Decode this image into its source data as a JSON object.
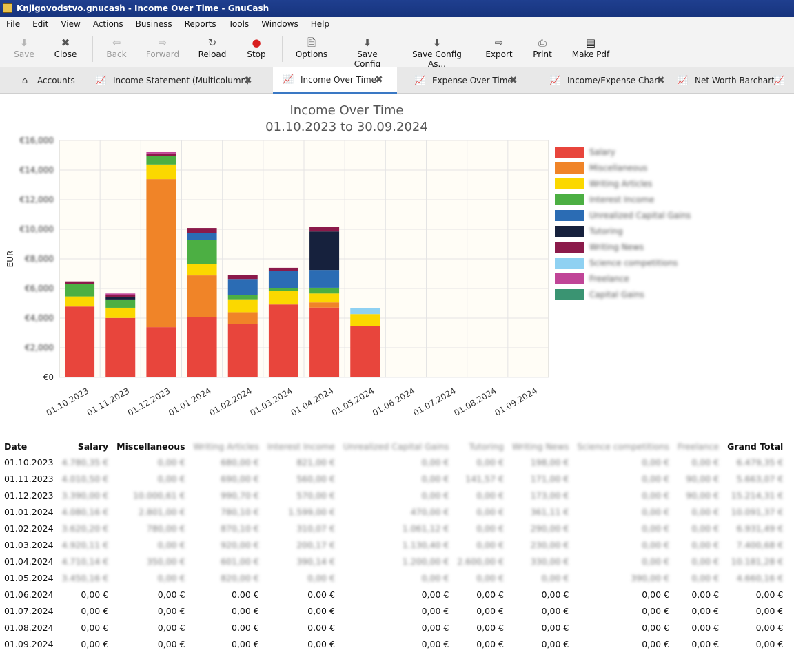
{
  "window": {
    "title": "Knjigovodstvo.gnucash - Income Over Time - GnuCash"
  },
  "menu": [
    "File",
    "Edit",
    "View",
    "Actions",
    "Business",
    "Reports",
    "Tools",
    "Windows",
    "Help"
  ],
  "toolbar": {
    "save": "Save",
    "close": "Close",
    "back": "Back",
    "forward": "Forward",
    "reload": "Reload",
    "stop": "Stop",
    "options": "Options",
    "save_config": "Save Config",
    "save_config_as": "Save Config As...",
    "export": "Export",
    "print": "Print",
    "make_pdf": "Make Pdf"
  },
  "tabs": [
    "Accounts",
    "Income Statement (Multicolumn)",
    "Income Over Time",
    "Expense Over Time",
    "Income/Expense Chart",
    "Net Worth Barchart"
  ],
  "chart_data": {
    "type": "bar",
    "stacked": true,
    "title": "Income Over Time",
    "subtitle": "01.10.2023 to 30.09.2024",
    "ylabel": "EUR",
    "ylim": [
      0,
      16000
    ],
    "y_ticks": [
      "€0",
      "€2,000",
      "€4,000",
      "€6,000",
      "€8,000",
      "€10,000",
      "€12,000",
      "€14,000",
      "€16,000"
    ],
    "legend_position": "right",
    "categories": [
      "01.10.2023",
      "01.11.2023",
      "01.12.2023",
      "01.01.2024",
      "01.02.2024",
      "01.03.2024",
      "01.04.2024",
      "01.05.2024",
      "01.06.2024",
      "01.07.2024",
      "01.08.2024",
      "01.09.2024"
    ],
    "series": [
      {
        "name": "Salary",
        "color": "#e8453c",
        "values": [
          4780,
          4010,
          3390,
          4080,
          3620,
          4920,
          4710,
          3450,
          0,
          0,
          0,
          0
        ]
      },
      {
        "name": "Miscellaneous",
        "color": "#f08428",
        "values": [
          0,
          0,
          10000,
          2800,
          780,
          0,
          350,
          0,
          0,
          0,
          0,
          0
        ]
      },
      {
        "name": "Writing Articles",
        "color": "#fbd800",
        "values": [
          680,
          690,
          990,
          780,
          870,
          920,
          600,
          820,
          0,
          0,
          0,
          0
        ]
      },
      {
        "name": "Interest Income",
        "color": "#4caf43",
        "values": [
          820,
          560,
          570,
          1600,
          310,
          200,
          390,
          0,
          0,
          0,
          0,
          0
        ]
      },
      {
        "name": "Unrealized Capital Gains",
        "color": "#2b6cb4",
        "values": [
          0,
          0,
          0,
          470,
          1060,
          1130,
          1200,
          0,
          0,
          0,
          0,
          0
        ]
      },
      {
        "name": "Tutoring",
        "color": "#16213d",
        "values": [
          0,
          140,
          0,
          0,
          0,
          0,
          2600,
          0,
          0,
          0,
          0,
          0
        ]
      },
      {
        "name": "Writing News",
        "color": "#8b1a4a",
        "values": [
          200,
          170,
          170,
          360,
          290,
          230,
          330,
          0,
          0,
          0,
          0,
          0
        ]
      },
      {
        "name": "Science competitions",
        "color": "#8fd1f2",
        "values": [
          0,
          0,
          0,
          0,
          0,
          0,
          0,
          390,
          0,
          0,
          0,
          0
        ]
      },
      {
        "name": "Freelance",
        "color": "#c04597",
        "values": [
          0,
          90,
          90,
          0,
          0,
          0,
          0,
          0,
          0,
          0,
          0,
          0
        ]
      },
      {
        "name": "Capital Gains",
        "color": "#3a9472",
        "values": [
          0,
          0,
          0,
          0,
          0,
          0,
          0,
          0,
          0,
          0,
          0,
          0
        ]
      }
    ]
  },
  "table": {
    "headers": [
      "Date",
      "Salary",
      "Miscellaneous",
      "Writing Articles",
      "Interest Income",
      "Unrealized Capital Gains",
      "Tutoring",
      "Writing News",
      "Science competitions",
      "Freelance",
      "Grand Total"
    ],
    "rows": [
      [
        "01.10.2023",
        "4.780,35 €",
        "0,00 €",
        "680,00 €",
        "821,00 €",
        "0,00 €",
        "0,00 €",
        "198,00 €",
        "0,00 €",
        "0,00 €",
        "6.479,35 €"
      ],
      [
        "01.11.2023",
        "4.010,50 €",
        "0,00 €",
        "690,00 €",
        "560,00 €",
        "0,00 €",
        "141,57 €",
        "171,00 €",
        "0,00 €",
        "90,00 €",
        "5.663,07 €"
      ],
      [
        "01.12.2023",
        "3.390,00 €",
        "10.000,61 €",
        "990,70 €",
        "570,00 €",
        "0,00 €",
        "0,00 €",
        "173,00 €",
        "0,00 €",
        "90,00 €",
        "15.214,31 €"
      ],
      [
        "01.01.2024",
        "4.080,16 €",
        "2.801,00 €",
        "780,10 €",
        "1.599,00 €",
        "470,00 €",
        "0,00 €",
        "361,11 €",
        "0,00 €",
        "0,00 €",
        "10.091,37 €"
      ],
      [
        "01.02.2024",
        "3.620,20 €",
        "780,00 €",
        "870,10 €",
        "310,07 €",
        "1.061,12 €",
        "0,00 €",
        "290,00 €",
        "0,00 €",
        "0,00 €",
        "6.931,49 €"
      ],
      [
        "01.03.2024",
        "4.920,11 €",
        "0,00 €",
        "920,00 €",
        "200,17 €",
        "1.130,40 €",
        "0,00 €",
        "230,00 €",
        "0,00 €",
        "0,00 €",
        "7.400,68 €"
      ],
      [
        "01.04.2024",
        "4.710,14 €",
        "350,00 €",
        "601,00 €",
        "390,14 €",
        "1.200,00 €",
        "2.600,00 €",
        "330,00 €",
        "0,00 €",
        "0,00 €",
        "10.181,28 €"
      ],
      [
        "01.05.2024",
        "3.450,16 €",
        "0,00 €",
        "820,00 €",
        "0,00 €",
        "0,00 €",
        "0,00 €",
        "0,00 €",
        "390,00 €",
        "0,00 €",
        "4.660,16 €"
      ],
      [
        "01.06.2024",
        "0,00 €",
        "0,00 €",
        "0,00 €",
        "0,00 €",
        "0,00 €",
        "0,00 €",
        "0,00 €",
        "0,00 €",
        "0,00 €",
        "0,00 €"
      ],
      [
        "01.07.2024",
        "0,00 €",
        "0,00 €",
        "0,00 €",
        "0,00 €",
        "0,00 €",
        "0,00 €",
        "0,00 €",
        "0,00 €",
        "0,00 €",
        "0,00 €"
      ],
      [
        "01.08.2024",
        "0,00 €",
        "0,00 €",
        "0,00 €",
        "0,00 €",
        "0,00 €",
        "0,00 €",
        "0,00 €",
        "0,00 €",
        "0,00 €",
        "0,00 €"
      ],
      [
        "01.09.2024",
        "0,00 €",
        "0,00 €",
        "0,00 €",
        "0,00 €",
        "0,00 €",
        "0,00 €",
        "0,00 €",
        "0,00 €",
        "0,00 €",
        "0,00 €"
      ]
    ]
  },
  "icons": {
    "save": "save-icon",
    "close": "close-icon",
    "back": "back-icon",
    "forward": "forward-icon",
    "reload": "reload-icon",
    "stop": "stop-icon",
    "options": "options-icon",
    "export": "export-icon",
    "print": "print-icon",
    "make_pdf": "pdf-icon",
    "tab_accounts": "accounts-icon",
    "tab_chart": "chart-icon",
    "tab_close": "tab-close-icon"
  }
}
